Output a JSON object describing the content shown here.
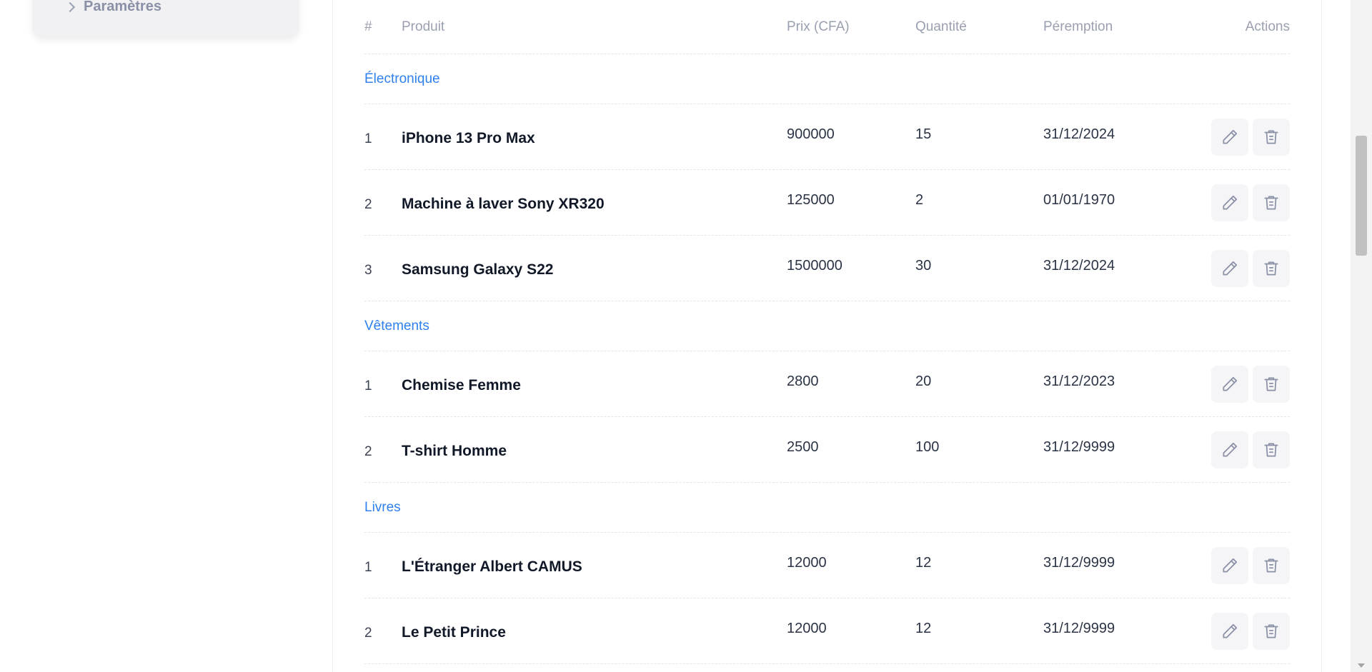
{
  "sidebar": {
    "items": [
      {
        "label": "Paramètres",
        "icon": "chevron-right-icon"
      }
    ]
  },
  "table": {
    "headers": {
      "num": "#",
      "product": "Produit",
      "price": "Prix (CFA)",
      "quantity": "Quantité",
      "expiry": "Péremption",
      "actions": "Actions"
    },
    "categories": [
      {
        "name": "Électronique",
        "rows": [
          {
            "num": "1",
            "product": "iPhone 13 Pro Max",
            "price": "900000",
            "quantity": "15",
            "expiry": "31/12/2024"
          },
          {
            "num": "2",
            "product": "Machine à laver Sony XR320",
            "price": "125000",
            "quantity": "2",
            "expiry": "01/01/1970"
          },
          {
            "num": "3",
            "product": "Samsung Galaxy S22",
            "price": "1500000",
            "quantity": "30",
            "expiry": "31/12/2024"
          }
        ]
      },
      {
        "name": "Vêtements",
        "rows": [
          {
            "num": "1",
            "product": "Chemise Femme",
            "price": "2800",
            "quantity": "20",
            "expiry": "31/12/2023"
          },
          {
            "num": "2",
            "product": "T-shirt Homme",
            "price": "2500",
            "quantity": "100",
            "expiry": "31/12/9999"
          }
        ]
      },
      {
        "name": "Livres",
        "rows": [
          {
            "num": "1",
            "product": "L'Étranger Albert CAMUS",
            "price": "12000",
            "quantity": "12",
            "expiry": "31/12/9999"
          },
          {
            "num": "2",
            "product": "Le Petit Prince",
            "price": "12000",
            "quantity": "12",
            "expiry": "31/12/9999"
          }
        ]
      }
    ],
    "row_actions": [
      "pencil-icon",
      "trash-icon"
    ]
  },
  "colors": {
    "category": "#2f80ed",
    "header_text": "#9aa0b0",
    "action_bg": "#f5f5f7",
    "icon": "#8a90a6"
  }
}
